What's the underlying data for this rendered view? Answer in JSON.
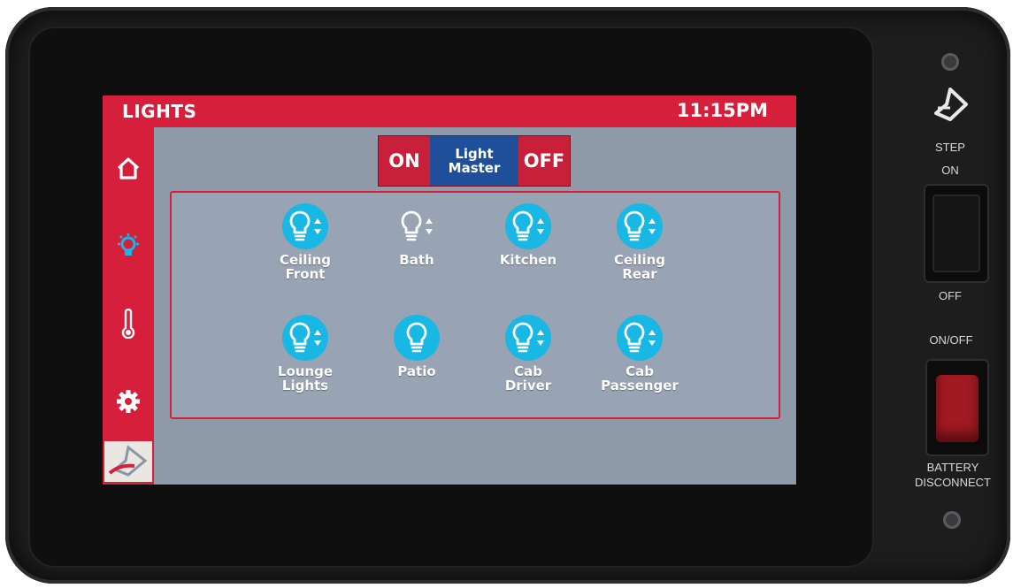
{
  "header": {
    "title": "LIGHTS",
    "time": "11:15PM"
  },
  "sidebar": {
    "items": [
      {
        "name": "home",
        "icon": "home-icon"
      },
      {
        "name": "lights",
        "icon": "light-bulb-icon"
      },
      {
        "name": "climate",
        "icon": "thermometer-icon"
      },
      {
        "name": "settings",
        "icon": "gear-icon"
      }
    ],
    "logo": "brand-logo-icon"
  },
  "master": {
    "on_label": "ON",
    "label_line1": "Light",
    "label_line2": "Master",
    "off_label": "OFF"
  },
  "lights": [
    {
      "line1": "Ceiling",
      "line2": "Front",
      "state": "on",
      "dimmable": true
    },
    {
      "line1": "Bath",
      "line2": "",
      "state": "off",
      "dimmable": true
    },
    {
      "line1": "Kitchen",
      "line2": "",
      "state": "on",
      "dimmable": true
    },
    {
      "line1": "Ceiling",
      "line2": "Rear",
      "state": "on",
      "dimmable": true
    },
    {
      "line1": "Lounge",
      "line2": "Lights",
      "state": "on",
      "dimmable": true
    },
    {
      "line1": "Patio",
      "line2": "",
      "state": "on",
      "dimmable": false
    },
    {
      "line1": "Cab",
      "line2": "Driver",
      "state": "on",
      "dimmable": true
    },
    {
      "line1": "Cab",
      "line2": "Passenger",
      "state": "on",
      "dimmable": true
    }
  ],
  "hardware": {
    "step_label": "STEP",
    "step_on": "ON",
    "step_off": "OFF",
    "battery_onoff": "ON/OFF",
    "battery_line1": "BATTERY",
    "battery_line2": "DISCONNECT"
  },
  "colors": {
    "accent": "#d61f3b",
    "master_blue": "#1f4f9a",
    "light_on": "#19b7e4",
    "screen_bg": "#8e9aa8"
  }
}
